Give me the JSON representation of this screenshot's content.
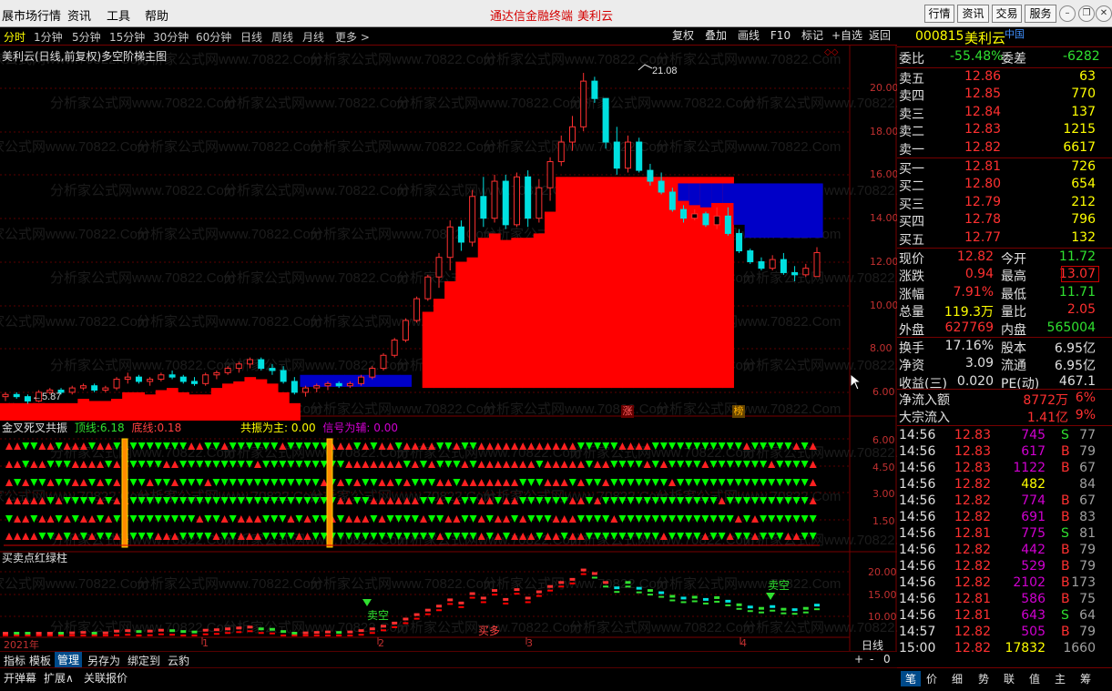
{
  "menu": {
    "items": [
      "展市场行情",
      "资讯",
      "工具",
      "帮助"
    ],
    "center1": "通达信金融终端",
    "center2": "美利云",
    "buttons": [
      "行情",
      "资讯",
      "交易",
      "服务"
    ]
  },
  "periods": {
    "items": [
      "分时",
      "1分钟",
      "5分钟",
      "15分钟",
      "30分钟",
      "60分钟",
      "日线",
      "周线",
      "月线",
      "更多 >"
    ],
    "active": "分时"
  },
  "toolbar": [
    "复权",
    "叠加",
    "画线",
    "F10",
    "标记",
    "+自选",
    "返回"
  ],
  "stock": {
    "code": "000815",
    "name": "美利云",
    "tag": "中国"
  },
  "main_chart": {
    "title": "美利云(日线,前复权)多空阶梯主图",
    "y_ticks": [
      "20.00",
      "18.00",
      "16.00",
      "14.00",
      "12.00",
      "10.00",
      "8.00",
      "6.00"
    ],
    "high_label": "21.08",
    "low_label": "5.87",
    "badge1": "涨",
    "badge2": "榜",
    "watermark": "分析家公式网www.70822.Com",
    "colors": {
      "up": "#ff3030",
      "down": "#00e0e0",
      "ladder_red": "#ff0000",
      "ladder_blue": "#0000c8"
    }
  },
  "chart_data": {
    "type": "candlestick",
    "title": "美利云(日线,前复权)多空阶梯主图",
    "high": 21.08,
    "low": 5.87,
    "ylim": [
      5.5,
      21.5
    ],
    "candles": [
      [
        6.2,
        6.4,
        6.0,
        6.3
      ],
      [
        6.3,
        6.4,
        6.1,
        6.2
      ],
      [
        6.2,
        6.3,
        5.87,
        6.0
      ],
      [
        6.0,
        6.5,
        5.95,
        6.4
      ],
      [
        6.4,
        6.6,
        6.3,
        6.5
      ],
      [
        6.5,
        6.6,
        6.3,
        6.4
      ],
      [
        6.4,
        6.7,
        6.3,
        6.6
      ],
      [
        6.6,
        6.8,
        6.5,
        6.7
      ],
      [
        6.7,
        6.8,
        6.4,
        6.5
      ],
      [
        6.5,
        6.7,
        6.4,
        6.6
      ],
      [
        6.6,
        7.1,
        6.5,
        7.0
      ],
      [
        7.0,
        7.3,
        6.8,
        7.1
      ],
      [
        7.1,
        7.2,
        6.8,
        6.9
      ],
      [
        6.9,
        7.1,
        6.7,
        7.0
      ],
      [
        7.0,
        7.3,
        6.9,
        7.2
      ],
      [
        7.2,
        7.4,
        7.0,
        7.1
      ],
      [
        7.1,
        7.2,
        6.8,
        6.9
      ],
      [
        6.9,
        7.1,
        6.7,
        6.8
      ],
      [
        6.8,
        7.3,
        6.7,
        7.2
      ],
      [
        7.2,
        7.4,
        7.0,
        7.3
      ],
      [
        7.3,
        7.6,
        7.2,
        7.5
      ],
      [
        7.5,
        7.8,
        7.3,
        7.7
      ],
      [
        7.7,
        8.0,
        7.5,
        7.9
      ],
      [
        7.9,
        8.0,
        7.4,
        7.5
      ],
      [
        7.5,
        7.7,
        7.2,
        7.4
      ],
      [
        7.4,
        7.6,
        6.8,
        6.9
      ],
      [
        6.9,
        7.1,
        6.3,
        6.4
      ],
      [
        6.4,
        6.7,
        6.2,
        6.6
      ],
      [
        6.6,
        6.8,
        6.4,
        6.7
      ],
      [
        6.7,
        6.9,
        6.5,
        6.8
      ],
      [
        6.8,
        6.9,
        6.6,
        6.7
      ],
      [
        6.7,
        6.9,
        6.6,
        6.8
      ],
      [
        6.8,
        7.2,
        6.7,
        7.1
      ],
      [
        7.1,
        7.6,
        7.0,
        7.5
      ],
      [
        7.5,
        8.2,
        7.4,
        8.1
      ],
      [
        8.1,
        8.9,
        8.0,
        8.8
      ],
      [
        8.8,
        9.8,
        8.7,
        9.7
      ],
      [
        9.7,
        10.8,
        9.6,
        10.7
      ],
      [
        10.7,
        11.8,
        10.6,
        11.7
      ],
      [
        11.7,
        12.8,
        11.2,
        12.6
      ],
      [
        12.6,
        14.3,
        12.0,
        14.0
      ],
      [
        14.0,
        14.3,
        12.9,
        13.3
      ],
      [
        13.3,
        15.7,
        13.1,
        15.4
      ],
      [
        15.4,
        16.3,
        14.0,
        14.4
      ],
      [
        14.4,
        16.4,
        14.2,
        16.1
      ],
      [
        16.1,
        16.4,
        13.9,
        14.1
      ],
      [
        14.1,
        16.5,
        14.0,
        16.3
      ],
      [
        16.3,
        16.6,
        14.0,
        14.4
      ],
      [
        14.4,
        16.2,
        14.2,
        15.8
      ],
      [
        15.8,
        17.2,
        15.2,
        17.0
      ],
      [
        17.0,
        18.2,
        16.8,
        17.9
      ],
      [
        17.9,
        19.1,
        17.5,
        18.6
      ],
      [
        18.6,
        21.08,
        18.4,
        20.7
      ],
      [
        20.7,
        20.9,
        19.7,
        19.9
      ],
      [
        19.9,
        19.3,
        17.6,
        17.9
      ],
      [
        17.9,
        18.6,
        16.4,
        16.7
      ],
      [
        16.7,
        18.2,
        16.5,
        17.9
      ],
      [
        17.9,
        18.1,
        16.5,
        16.6
      ],
      [
        16.6,
        16.9,
        15.9,
        16.1
      ],
      [
        16.1,
        16.5,
        15.5,
        15.6
      ],
      [
        15.6,
        15.8,
        14.7,
        14.8
      ],
      [
        14.8,
        15.0,
        14.2,
        14.4
      ],
      [
        14.4,
        14.8,
        14.3,
        14.6
      ],
      [
        14.6,
        14.7,
        14.0,
        14.1
      ],
      [
        14.1,
        14.9,
        13.9,
        14.5
      ],
      [
        14.5,
        14.9,
        13.6,
        13.7
      ],
      [
        13.7,
        13.9,
        12.8,
        12.9
      ],
      [
        12.9,
        13.0,
        12.3,
        12.4
      ],
      [
        12.4,
        12.6,
        12.0,
        12.1
      ],
      [
        12.1,
        12.7,
        12.0,
        12.5
      ],
      [
        12.5,
        12.8,
        11.8,
        11.9
      ],
      [
        11.9,
        12.2,
        11.5,
        11.8
      ],
      [
        11.8,
        12.3,
        11.7,
        12.1
      ],
      [
        11.72,
        13.07,
        11.71,
        12.82
      ]
    ]
  },
  "sub1": {
    "title": "金叉死叉共振",
    "label_top": "顶线:",
    "val_top": "6.18",
    "label_bottom": "底线:",
    "val_bottom": "0.18",
    "label_main": "共振为主:",
    "val_main": "0.00",
    "label_sig": "信号为辅:",
    "val_sig": "0.00",
    "y_ticks": [
      "6.00",
      "4.50",
      "3.00",
      "1.50"
    ]
  },
  "sub2": {
    "title": "买卖点红绿柱",
    "y_ticks": [
      "20.00",
      "15.00",
      "10.00"
    ],
    "sig1": "卖空",
    "sig2": "卖空",
    "sig3": "买多"
  },
  "x_axis": {
    "labels": [
      "2021年",
      "1",
      "2",
      "3",
      "4"
    ],
    "period": "日线"
  },
  "bottom_tabs": [
    "指标",
    "模板",
    "管理",
    "另存为",
    "绑定到",
    "云豹"
  ],
  "bottom_bar": [
    "开弹幕",
    "扩展∧",
    "关联报价"
  ],
  "right_tabs": [
    "笔",
    "价",
    "细",
    "势",
    "联",
    "值",
    "主",
    "筹"
  ],
  "quote": {
    "weibi_label": "委比",
    "weibi": "-55.48%",
    "weicha_label": "委差",
    "weicha": "-6282",
    "sells": [
      [
        "卖五",
        "12.86",
        "63"
      ],
      [
        "卖四",
        "12.85",
        "770"
      ],
      [
        "卖三",
        "12.84",
        "137"
      ],
      [
        "卖二",
        "12.83",
        "1215"
      ],
      [
        "卖一",
        "12.82",
        "6617"
      ]
    ],
    "buys": [
      [
        "买一",
        "12.81",
        "726"
      ],
      [
        "买二",
        "12.80",
        "654"
      ],
      [
        "买三",
        "12.79",
        "212"
      ],
      [
        "买四",
        "12.78",
        "796"
      ],
      [
        "买五",
        "12.77",
        "132"
      ]
    ],
    "stats": [
      [
        "现价",
        "12.82",
        "今开",
        "11.72"
      ],
      [
        "涨跌",
        "0.94",
        "最高",
        "13.07"
      ],
      [
        "涨幅",
        "7.91%",
        "最低",
        "11.71"
      ],
      [
        "总量",
        "119.3万",
        "量比",
        "2.05"
      ],
      [
        "外盘",
        "627769",
        "内盘",
        "565004"
      ]
    ],
    "stats2": [
      [
        "换手",
        "17.16%",
        "股本",
        "6.95亿"
      ],
      [
        "净资",
        "3.09",
        "流通",
        "6.95亿"
      ],
      [
        "收益(三)",
        "0.020",
        "PE(动)",
        "467.1"
      ]
    ],
    "flow": [
      [
        "净流入额",
        "8772万",
        "6%"
      ],
      [
        "大宗流入",
        "1.41亿",
        "9%"
      ]
    ]
  },
  "ticks": [
    [
      "14:56",
      "12.83",
      "745",
      "S",
      "77"
    ],
    [
      "14:56",
      "12.83",
      "617",
      "B",
      "79"
    ],
    [
      "14:56",
      "12.83",
      "1122",
      "B",
      "67"
    ],
    [
      "14:56",
      "12.82",
      "482",
      "",
      "84"
    ],
    [
      "14:56",
      "12.82",
      "774",
      "B",
      "67"
    ],
    [
      "14:56",
      "12.82",
      "691",
      "B",
      "83"
    ],
    [
      "14:56",
      "12.81",
      "775",
      "S",
      "81"
    ],
    [
      "14:56",
      "12.82",
      "442",
      "B",
      "79"
    ],
    [
      "14:56",
      "12.82",
      "529",
      "B",
      "79"
    ],
    [
      "14:56",
      "12.82",
      "2102",
      "B",
      "173"
    ],
    [
      "14:56",
      "12.81",
      "586",
      "B",
      "75"
    ],
    [
      "14:56",
      "12.81",
      "643",
      "S",
      "64"
    ],
    [
      "14:57",
      "12.82",
      "505",
      "B",
      "79"
    ],
    [
      "15:00",
      "12.82",
      "17832",
      "",
      "1660"
    ]
  ]
}
